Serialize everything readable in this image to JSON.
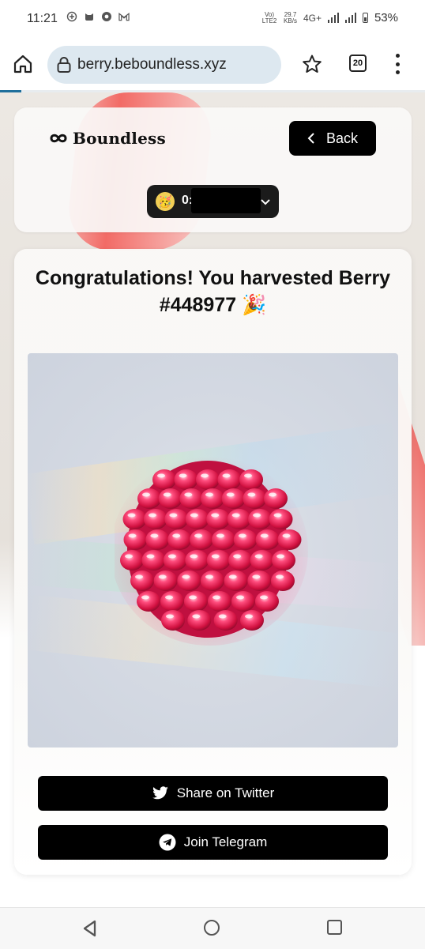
{
  "status_bar": {
    "time": "11:21",
    "network_label": "Vo) LTE2",
    "speed_value": "29.7",
    "speed_unit": "KB/s",
    "network_type": "4G+",
    "battery": "53%"
  },
  "browser": {
    "url": "berry.beboundless.xyz",
    "tab_count": "20",
    "load_progress": 0.05
  },
  "header": {
    "brand": "Boundless",
    "back_label": "Back",
    "wallet_address_visible": "0:"
  },
  "main": {
    "title": "Congratulations! You harvested Berry #448977 🎉",
    "share_twitter_label": "Share on Twitter",
    "join_telegram_label": "Join Telegram"
  },
  "colors": {
    "button_bg": "#000000",
    "url_pill_bg": "#dde8f0",
    "berry_red": "#e8164f",
    "ribbon": "#f26b66"
  },
  "icons": [
    "home-icon",
    "lock-icon",
    "star-icon",
    "menu-icon",
    "twitter-icon",
    "telegram-icon",
    "chevron-left-icon",
    "chevron-down-icon"
  ]
}
